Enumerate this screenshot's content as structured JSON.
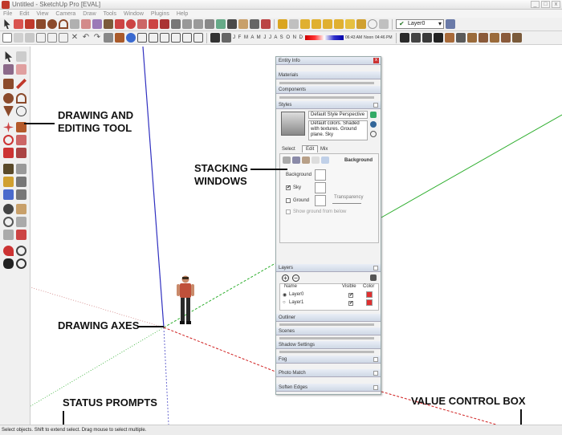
{
  "window": {
    "title": "Untitled - SketchUp Pro [EVAL]"
  },
  "menu": [
    "File",
    "Edit",
    "View",
    "Camera",
    "Draw",
    "Tools",
    "Window",
    "Plugins",
    "Help"
  ],
  "toolbar": {
    "layer_select": "Layer0",
    "shadow_months": "J F M A M J J A S O N D",
    "shadow_time_start": "06:43 AM",
    "shadow_time_noon": "Noon",
    "shadow_time_end": "04:46 PM"
  },
  "panel": {
    "title": "Entity Info",
    "sections": {
      "materials": "Materials",
      "components": "Components",
      "styles": "Styles",
      "layers": "Layers",
      "outliner": "Outliner",
      "scenes": "Scenes",
      "shadow_settings": "Shadow Settings",
      "fog": "Fog",
      "photo_match": "Photo Match",
      "soften_edges": "Soften Edges"
    },
    "style": {
      "name": "Default Style Perspective",
      "description": "Default colors. Shaded with textures. Ground plane. Sky",
      "tabs": [
        "Select",
        "Edit",
        "Mix"
      ],
      "background_label": "Background",
      "bg_field": "Background",
      "sky_label": "Sky",
      "ground_label": "Ground",
      "transparency_label": "Transparency",
      "show_ground_label": "Show ground from below"
    },
    "layers": {
      "col_name": "Name",
      "col_visible": "Visible",
      "col_color": "Color",
      "rows": [
        {
          "name": "Layer0",
          "visible": "✔",
          "color": "#e03030"
        },
        {
          "name": "Layer1",
          "visible": "✔",
          "color": "#e03030"
        }
      ]
    }
  },
  "annotations": {
    "drawing_tool": "DRAWING AND\nEDITING TOOL",
    "stacking": "STACKING\nWINDOWS",
    "axes": "DRAWING AXES",
    "status": "STATUS PROMPTS",
    "vcb": "VALUE CONTROL BOX"
  },
  "status": {
    "prompt": "Select objects. Shift to extend select. Drag mouse to select multiple."
  },
  "colors": {
    "axis_blue": "#3030c0",
    "axis_green": "#2eae2e",
    "axis_red": "#d02020",
    "panel_header": "#cfd8e6"
  }
}
